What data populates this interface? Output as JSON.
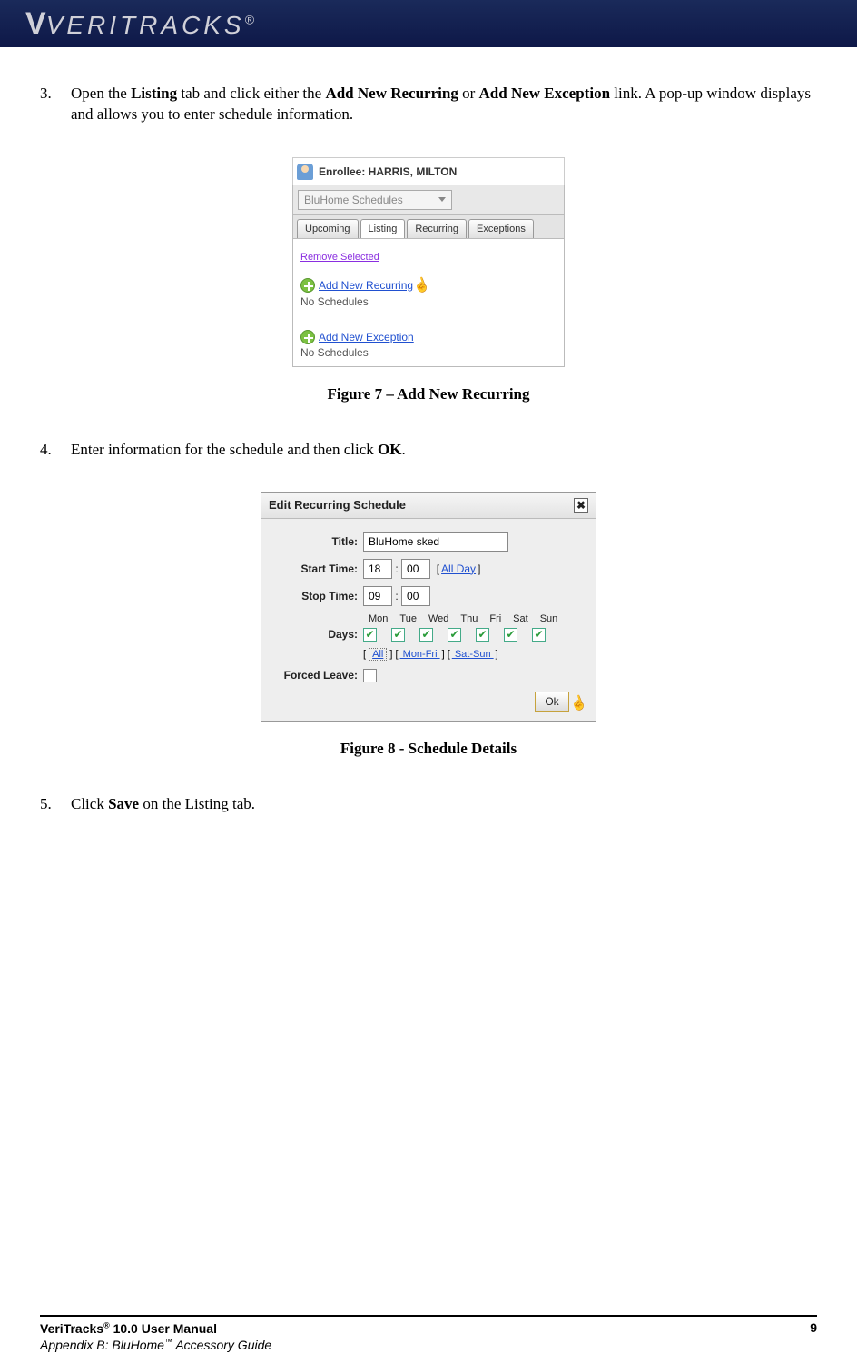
{
  "header": {
    "brand": "VERITRACKS",
    "reg": "®"
  },
  "steps": {
    "s3": {
      "num": "3.",
      "text_a": "Open the ",
      "b1": "Listing",
      "text_b": " tab and click either the ",
      "b2": "Add New Recurring",
      "text_c": " or ",
      "b3": "Add New Exception",
      "text_d": " link. A pop-up window displays and allows you to enter schedule information."
    },
    "s4": {
      "num": "4.",
      "text_a": "Enter information for the schedule and then click ",
      "b1": "OK",
      "text_b": "."
    },
    "s5": {
      "num": "5.",
      "text_a": "Click ",
      "b1": "Save",
      "text_b": " on the Listing tab."
    }
  },
  "fig7": {
    "caption": "Figure 7 – Add New Recurring",
    "enrollee_label": "Enrollee: HARRIS, MILTON",
    "dropdown": "BluHome Schedules",
    "tabs": [
      "Upcoming",
      "Listing",
      "Recurring",
      "Exceptions"
    ],
    "remove": "Remove Selected",
    "add_recurring": " Add New Recurring",
    "add_exception": " Add New Exception",
    "no_schedules": "No Schedules"
  },
  "fig8": {
    "caption": "Figure 8 - Schedule Details",
    "dialog_title": "Edit Recurring Schedule",
    "close": "✖",
    "labels": {
      "title": "Title:",
      "start": "Start Time:",
      "stop": "Stop Time:",
      "days": "Days:",
      "forced": "Forced Leave:"
    },
    "values": {
      "title": "BluHome sked",
      "start_h": "18",
      "start_m": "00",
      "stop_h": "09",
      "stop_m": "00"
    },
    "allday": " All Day ",
    "day_names": [
      "Mon",
      "Tue",
      "Wed",
      "Thu",
      "Fri",
      "Sat",
      "Sun"
    ],
    "presets": {
      "all": "All",
      "mf": " Mon-Fri ",
      "ss": " Sat-Sun "
    },
    "ok": "Ok",
    "colon": ":"
  },
  "footer": {
    "line1a": "VeriTracks",
    "sup1": "®",
    "line1b": " 10.0 User Manual",
    "line2a": "Appendix B: BluHome",
    "sup2": "™",
    "line2b": " Accessory Guide",
    "page": "9"
  }
}
